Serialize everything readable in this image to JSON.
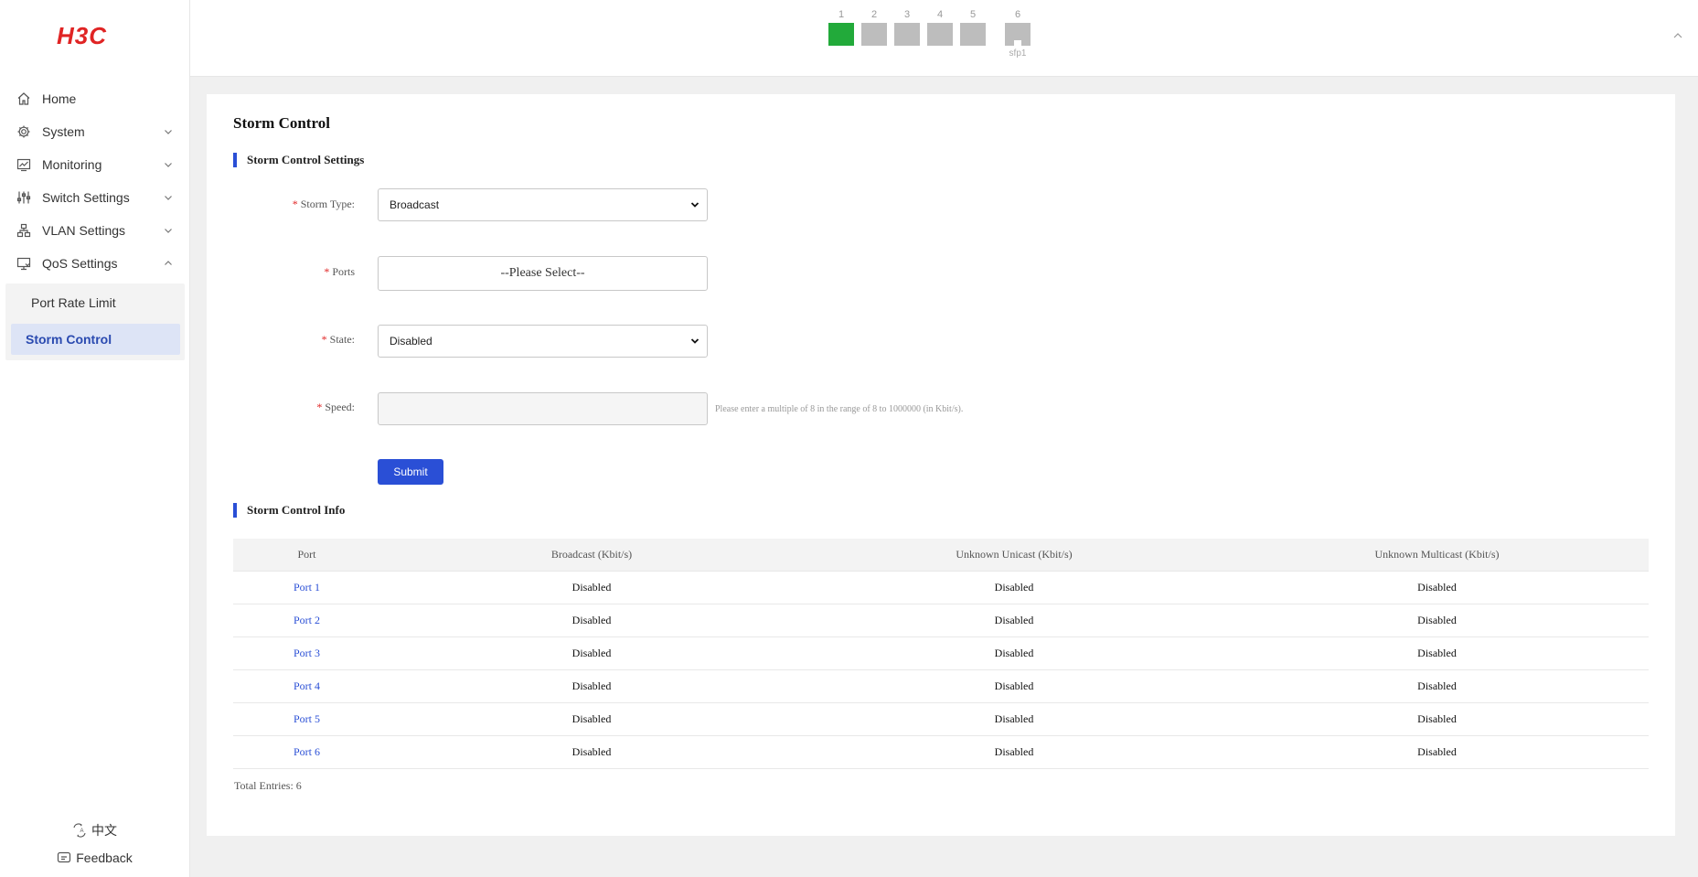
{
  "brand": {
    "logo_text": "H3C",
    "color": "#e02424"
  },
  "sidebar": {
    "items": [
      {
        "label": "Home",
        "icon": "home-icon",
        "expandable": false
      },
      {
        "label": "System",
        "icon": "gear-icon",
        "expandable": true
      },
      {
        "label": "Monitoring",
        "icon": "monitor-chart-icon",
        "expandable": true
      },
      {
        "label": "Switch Settings",
        "icon": "sliders-icon",
        "expandable": true
      },
      {
        "label": "VLAN Settings",
        "icon": "network-icon",
        "expandable": true
      },
      {
        "label": "QoS Settings",
        "icon": "qos-icon",
        "expandable": true,
        "expanded": true
      }
    ],
    "submenu": [
      {
        "label": "Port Rate Limit",
        "active": false
      },
      {
        "label": "Storm Control",
        "active": true
      }
    ],
    "language_label": "中文",
    "feedback_label": "Feedback"
  },
  "ports": [
    {
      "number": "1",
      "type": "rj45",
      "status": "up"
    },
    {
      "number": "2",
      "type": "rj45",
      "status": "down"
    },
    {
      "number": "3",
      "type": "rj45",
      "status": "down"
    },
    {
      "number": "4",
      "type": "rj45",
      "status": "down"
    },
    {
      "number": "5",
      "type": "rj45",
      "status": "down"
    },
    {
      "number": "6",
      "type": "sfp",
      "status": "down",
      "sub_label": "sfp1"
    }
  ],
  "page": {
    "title": "Storm Control",
    "settings_title": "Storm Control Settings",
    "info_title": "Storm Control Info"
  },
  "form": {
    "storm_type": {
      "label": "Storm Type:",
      "value": "Broadcast"
    },
    "ports": {
      "label": "Ports",
      "placeholder": "--Please Select--"
    },
    "state": {
      "label": "State:",
      "value": "Disabled"
    },
    "speed": {
      "label": "Speed:",
      "value": "",
      "hint": "Please enter a multiple of 8 in the range of 8 to 1000000 (in Kbit/s)."
    },
    "required_mark": "*",
    "submit_label": "Submit"
  },
  "table": {
    "columns": [
      "Port",
      "Broadcast (Kbit/s)",
      "Unknown Unicast (Kbit/s)",
      "Unknown Multicast (Kbit/s)"
    ],
    "rows": [
      [
        "Port 1",
        "Disabled",
        "Disabled",
        "Disabled"
      ],
      [
        "Port 2",
        "Disabled",
        "Disabled",
        "Disabled"
      ],
      [
        "Port 3",
        "Disabled",
        "Disabled",
        "Disabled"
      ],
      [
        "Port 4",
        "Disabled",
        "Disabled",
        "Disabled"
      ],
      [
        "Port 5",
        "Disabled",
        "Disabled",
        "Disabled"
      ],
      [
        "Port 6",
        "Disabled",
        "Disabled",
        "Disabled"
      ]
    ],
    "total_label": "Total Entries: 6"
  },
  "colors": {
    "accent": "#2a4fd6",
    "port_up": "#22aa3a",
    "port_down": "#bdbdbd",
    "active_bg": "#dde4f6"
  }
}
